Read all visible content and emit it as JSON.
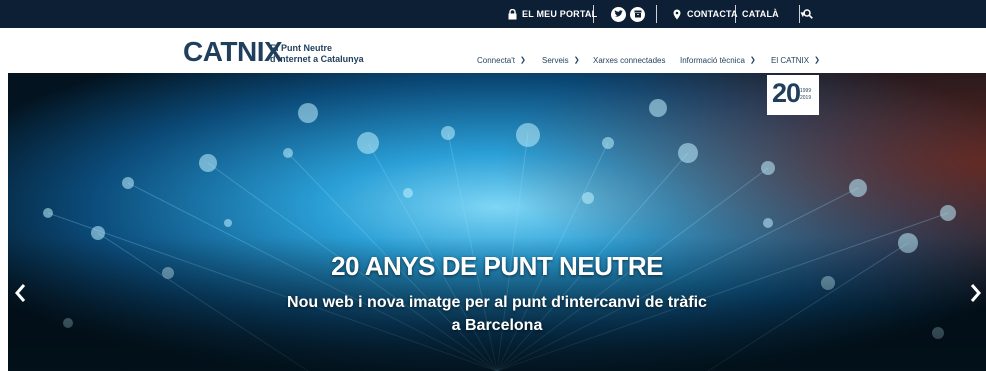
{
  "topbar": {
    "portal_label": "EL MEU PORTAL",
    "contact_label": "CONTACTA",
    "language": "CATALÀ",
    "icons": [
      "lock-icon",
      "twitter-icon",
      "archive-icon",
      "location-pin-icon",
      "search-icon"
    ]
  },
  "brand": {
    "logo": "CATNIX",
    "tagline_line1": "El Punt Neutre",
    "tagline_line2": "d'Internet a Catalunya"
  },
  "nav": {
    "items": [
      {
        "label": "Connecta't",
        "has_dropdown": true
      },
      {
        "label": "Serveis",
        "has_dropdown": true
      },
      {
        "label": "Xarxes connectades",
        "has_dropdown": false
      },
      {
        "label": "Informació tècnica",
        "has_dropdown": true
      },
      {
        "label": "El CATNIX",
        "has_dropdown": true
      }
    ]
  },
  "badge": {
    "number": "20",
    "years": [
      "1999",
      "2019"
    ]
  },
  "hero": {
    "title": "20 ANYS DE PUNT NEUTRE",
    "subtitle_line1": "Nou web i nova imatge per al punt d'intercanvi de tràfic",
    "subtitle_line2": "a Barcelona"
  },
  "colors": {
    "topbar_bg": "#0d1f35",
    "brand_dark": "#1f3f5c",
    "brand_accent": "#2a8fc4",
    "hero_glow": "#2fa6d9"
  }
}
